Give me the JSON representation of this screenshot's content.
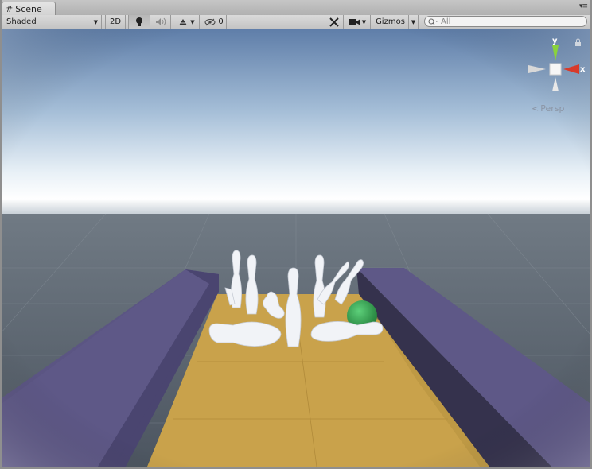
{
  "window": {
    "tab_title": "Scene"
  },
  "toolbar": {
    "draw_mode": "Shaded",
    "mode_2d": "2D",
    "effects_count": "0",
    "gizmos_label": "Gizmos",
    "search_placeholder": "All"
  },
  "gizmo": {
    "y_label": "y",
    "x_label": "x",
    "projection": "Persp"
  },
  "colors": {
    "sky_top": "#5f7fa8",
    "horizon": "#ffffff",
    "ground": "#5c6670",
    "lane": "#c8a24a",
    "rails": "#5e5887",
    "ball": "#2e9b4a",
    "pins": "#f2f4f8"
  },
  "icons": [
    "scene-grid-icon",
    "light-bulb-icon",
    "audio-icon",
    "effects-icon",
    "hidden-objects-icon",
    "tools-icon",
    "camera-icon",
    "search-icon",
    "lock-icon"
  ]
}
